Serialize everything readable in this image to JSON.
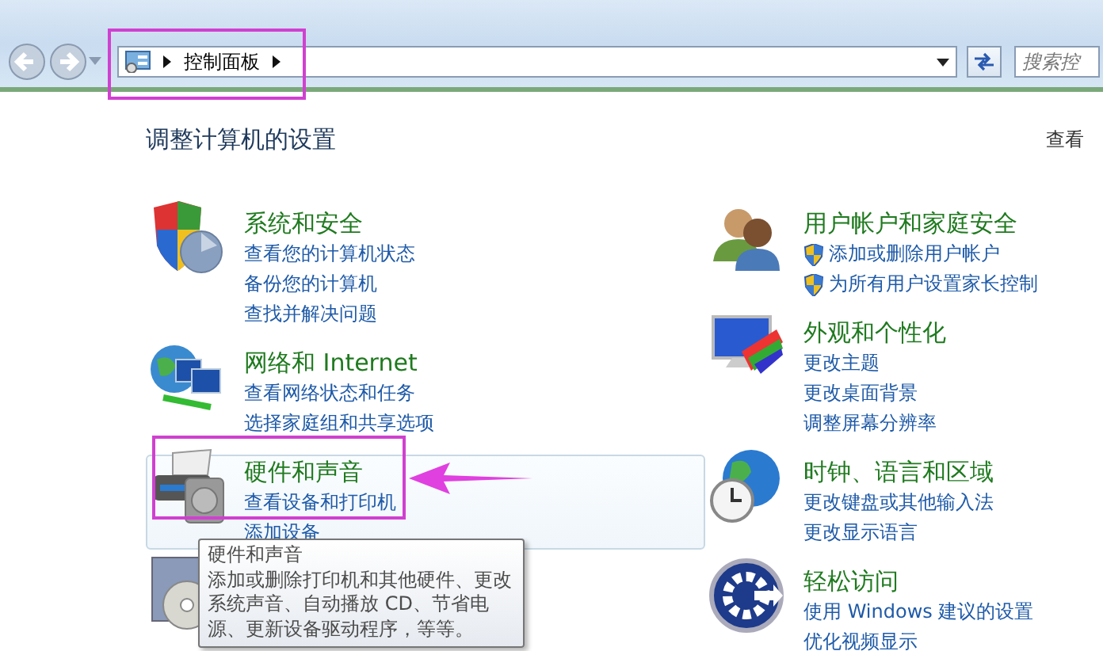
{
  "address_bar": {
    "crumbs": [
      "控制面板"
    ]
  },
  "search": {
    "placeholder": "搜索控"
  },
  "heading": "调整计算机的设置",
  "view_by": "查看",
  "left_categories": [
    {
      "title": "系统和安全",
      "hovered": false,
      "links": [
        {
          "text": "查看您的计算机状态"
        },
        {
          "text": "备份您的计算机"
        },
        {
          "text": "查找并解决问题"
        }
      ]
    },
    {
      "title": "网络和 Internet",
      "hovered": false,
      "links": [
        {
          "text": "查看网络状态和任务"
        },
        {
          "text": "选择家庭组和共享选项"
        }
      ]
    },
    {
      "title": "硬件和声音",
      "hovered": true,
      "links": [
        {
          "text": "查看设备和打印机"
        },
        {
          "text": "添加设备"
        }
      ]
    }
  ],
  "right_categories": [
    {
      "title": "用户帐户和家庭安全",
      "hovered": false,
      "links": [
        {
          "text": "添加或删除用户帐户",
          "shield": true
        },
        {
          "text": "为所有用户设置家长控制",
          "shield": true
        }
      ]
    },
    {
      "title": "外观和个性化",
      "hovered": false,
      "links": [
        {
          "text": "更改主题"
        },
        {
          "text": "更改桌面背景"
        },
        {
          "text": "调整屏幕分辨率"
        }
      ]
    },
    {
      "title": "时钟、语言和区域",
      "hovered": false,
      "links": [
        {
          "text": "更改键盘或其他输入法"
        },
        {
          "text": "更改显示语言"
        }
      ]
    },
    {
      "title": "轻松访问",
      "hovered": false,
      "links": [
        {
          "text": "使用 Windows 建议的设置"
        },
        {
          "text": "优化视频显示"
        }
      ]
    }
  ],
  "tooltip": {
    "title": "硬件和声音",
    "text": "添加或删除打印机和其他硬件、更改系统声音、自动播放 CD、节省电源、更新设备驱动程序，等等。"
  }
}
